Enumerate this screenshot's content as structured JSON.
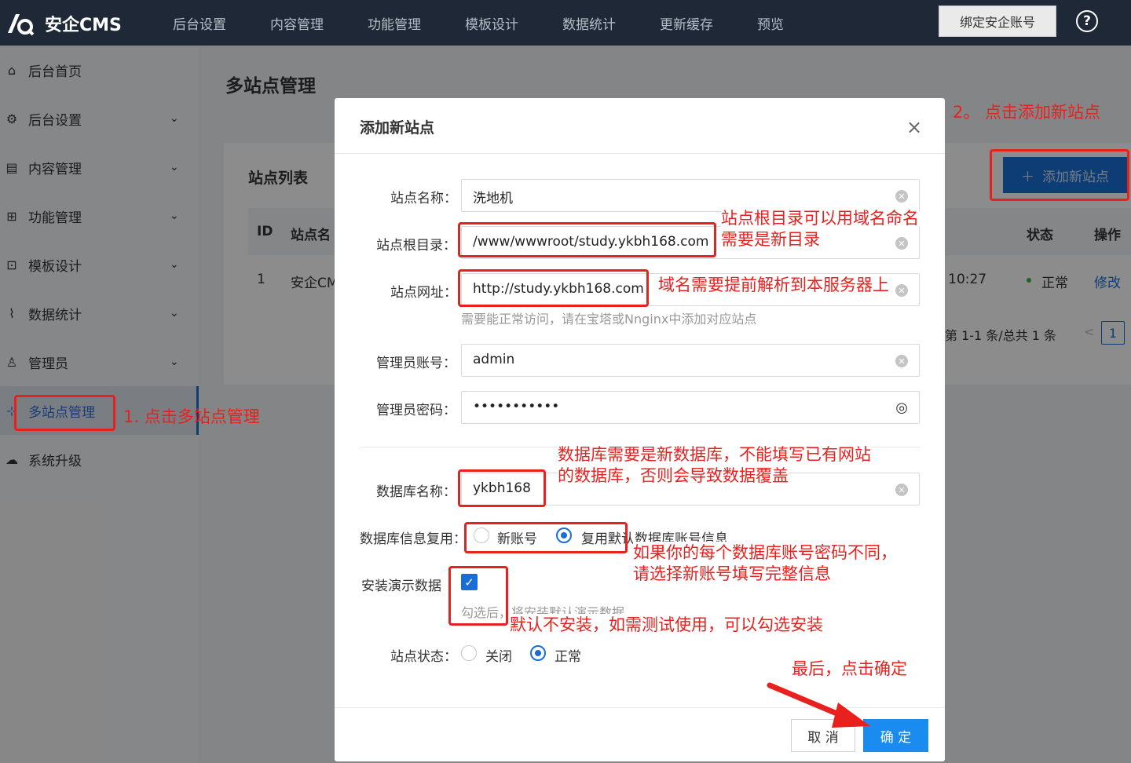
{
  "topbar": {
    "brand": "安企CMS",
    "nav": [
      "后台设置",
      "内容管理",
      "功能管理",
      "模板设计",
      "数据统计",
      "更新缓存",
      "预览"
    ],
    "bind_button": "绑定安企账号",
    "help": "?"
  },
  "sidebar": {
    "items": [
      {
        "label": "后台首页",
        "icon": "home-icon",
        "has_chevron": false
      },
      {
        "label": "后台设置",
        "icon": "gear-icon",
        "has_chevron": true
      },
      {
        "label": "内容管理",
        "icon": "document-icon",
        "has_chevron": true
      },
      {
        "label": "功能管理",
        "icon": "grid-icon",
        "has_chevron": true
      },
      {
        "label": "模板设计",
        "icon": "template-icon",
        "has_chevron": true
      },
      {
        "label": "数据统计",
        "icon": "chart-icon",
        "has_chevron": true
      },
      {
        "label": "管理员",
        "icon": "user-icon",
        "has_chevron": true
      },
      {
        "label": "多站点管理",
        "icon": "sitemap-icon",
        "has_chevron": false,
        "active": true
      },
      {
        "label": "系统升级",
        "icon": "cloud-icon",
        "has_chevron": false
      }
    ]
  },
  "main": {
    "page_title": "多站点管理",
    "card_title": "站点列表",
    "add_site_button": "添加新站点",
    "table": {
      "headers": {
        "id": "ID",
        "name": "站点名",
        "status": "状态",
        "action": "操作"
      },
      "row": {
        "id": "1",
        "name": "安企CM",
        "time": "/ 10:27",
        "status": "正常",
        "action": "修改"
      }
    },
    "pager": {
      "summary": "第 1-1 条/总共 1 条",
      "prev": "<",
      "page": "1"
    }
  },
  "modal": {
    "title": "添加新站点",
    "close": "×",
    "fields": {
      "site_name": {
        "label": "站点名称：",
        "value": "洗地机"
      },
      "root_dir": {
        "label": "站点根目录：",
        "value": "/www/wwwroot/study.ykbh168.com"
      },
      "site_url": {
        "label": "站点网址：",
        "value": "http://study.ykbh168.com",
        "hint": "需要能正常访问，请在宝塔或Nnginx中添加对应站点"
      },
      "admin_user": {
        "label": "管理员账号：",
        "value": "admin"
      },
      "admin_pass": {
        "label": "管理员密码：",
        "value": "•••••••••••"
      },
      "db_name": {
        "label": "数据库名称：",
        "value": "ykbh168"
      },
      "db_reuse": {
        "label": "数据库信息复用：",
        "option_new": "新账号",
        "option_reuse": "复用默认数据库账号信息",
        "selected": "reuse"
      },
      "demo_data": {
        "label": "安装演示数据",
        "checked": true,
        "hint": "勾选后，将安装默认演示数据"
      },
      "site_status": {
        "label": "站点状态：",
        "option_off": "关闭",
        "option_on": "正常",
        "selected": "on"
      }
    },
    "cancel_button": "取 消",
    "ok_button": "确 定"
  },
  "annotations": {
    "step1": "1. 点击多站点管理",
    "step2": "2。 点击添加新站点",
    "root_dir_note_1": "站点根目录可以用域名命名",
    "root_dir_note_2": "需要是新目录",
    "domain_note": "域名需要提前解析到本服务器上",
    "db_note_1": "数据库需要是新数据库，不能填写已有网站",
    "db_note_2": "的数据库，否则会导致数据覆盖",
    "reuse_note_1": "如果你的每个数据库账号密码不同，",
    "reuse_note_2": "请选择新账号填写完整信息",
    "demo_note": "默认不安装，如需测试使用，可以勾选安装",
    "final_note": "最后，点击确定"
  },
  "colors": {
    "accent": "#1a6dd6",
    "annotation": "#e8211f",
    "topbar": "#1e2836"
  }
}
